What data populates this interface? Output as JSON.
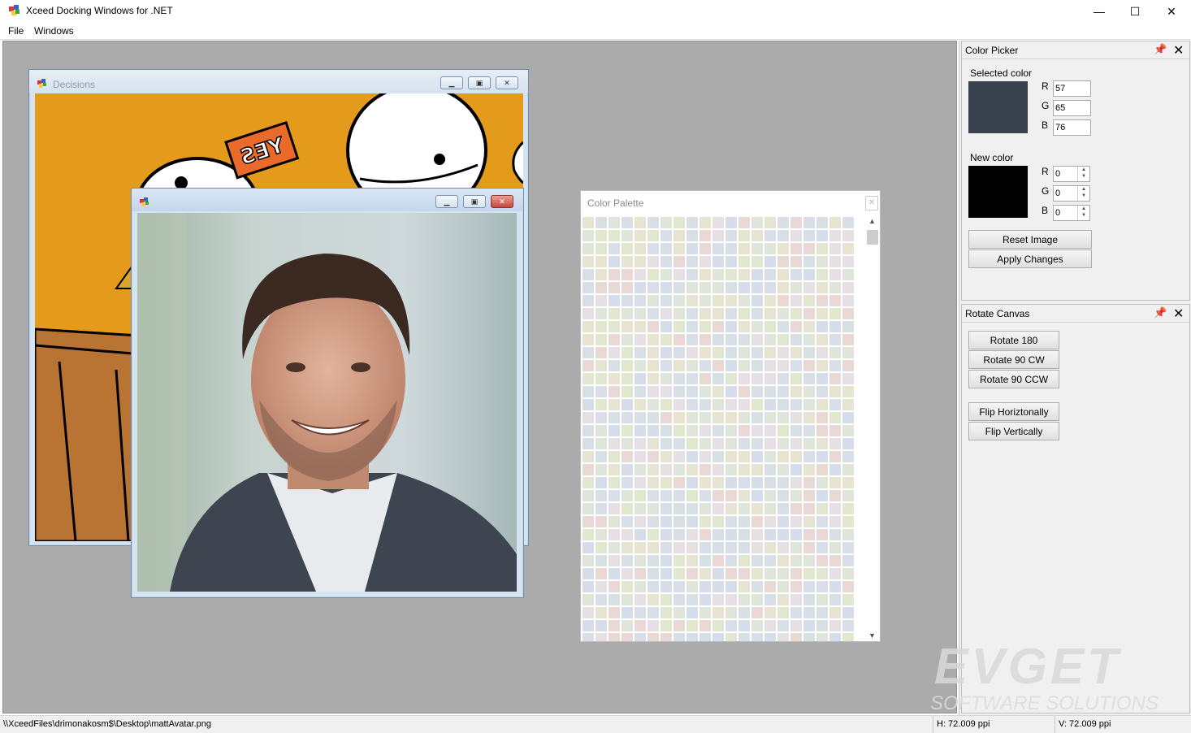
{
  "app": {
    "title": "Xceed Docking Windows for .NET"
  },
  "menu": [
    "File",
    "Windows"
  ],
  "window_controls": {
    "minimize": "—",
    "maximize": "☐",
    "close": "✕"
  },
  "decisions_window": {
    "title": "Decisions",
    "sign_text": "YES",
    "buttons": {
      "minimize": "▁",
      "maximize": "▣",
      "close": "✕"
    }
  },
  "avatar_window": {
    "title": "",
    "buttons": {
      "minimize": "▁",
      "maximize": "▣",
      "close": "✕"
    }
  },
  "color_palette": {
    "title": "Color Palette",
    "close": "✕",
    "scroll_up": "▲",
    "scroll_down": "▼"
  },
  "color_picker": {
    "title": "Color Picker",
    "selected_label": "Selected color",
    "selected_color": "#39414c",
    "selected": [
      {
        "label": "R",
        "value": "57"
      },
      {
        "label": "G",
        "value": "65"
      },
      {
        "label": "B",
        "value": "76"
      }
    ],
    "new_label": "New color",
    "new_color": "#000000",
    "new": [
      {
        "label": "R",
        "value": "0"
      },
      {
        "label": "G",
        "value": "0"
      },
      {
        "label": "B",
        "value": "0"
      }
    ],
    "reset_button": "Reset Image",
    "apply_button": "Apply Changes"
  },
  "rotate_canvas": {
    "title": "Rotate Canvas",
    "buttons": [
      "Rotate 180",
      "Rotate 90 CW",
      "Rotate 90 CCW",
      "Flip Horiztonally",
      "Flip Vertically"
    ]
  },
  "status": {
    "path": "\\\\XceedFiles\\drimonakosm$\\Desktop\\mattAvatar.png",
    "h": "H: 72.009 ppi",
    "v": "V: 72.009 ppi"
  },
  "watermark": {
    "line1": "EVGET",
    "line2": "SOFTWARE SOLUTIONS"
  },
  "colors": {
    "cartoon_bg": "#e49a1a",
    "mdi_bg": "#ababab"
  }
}
